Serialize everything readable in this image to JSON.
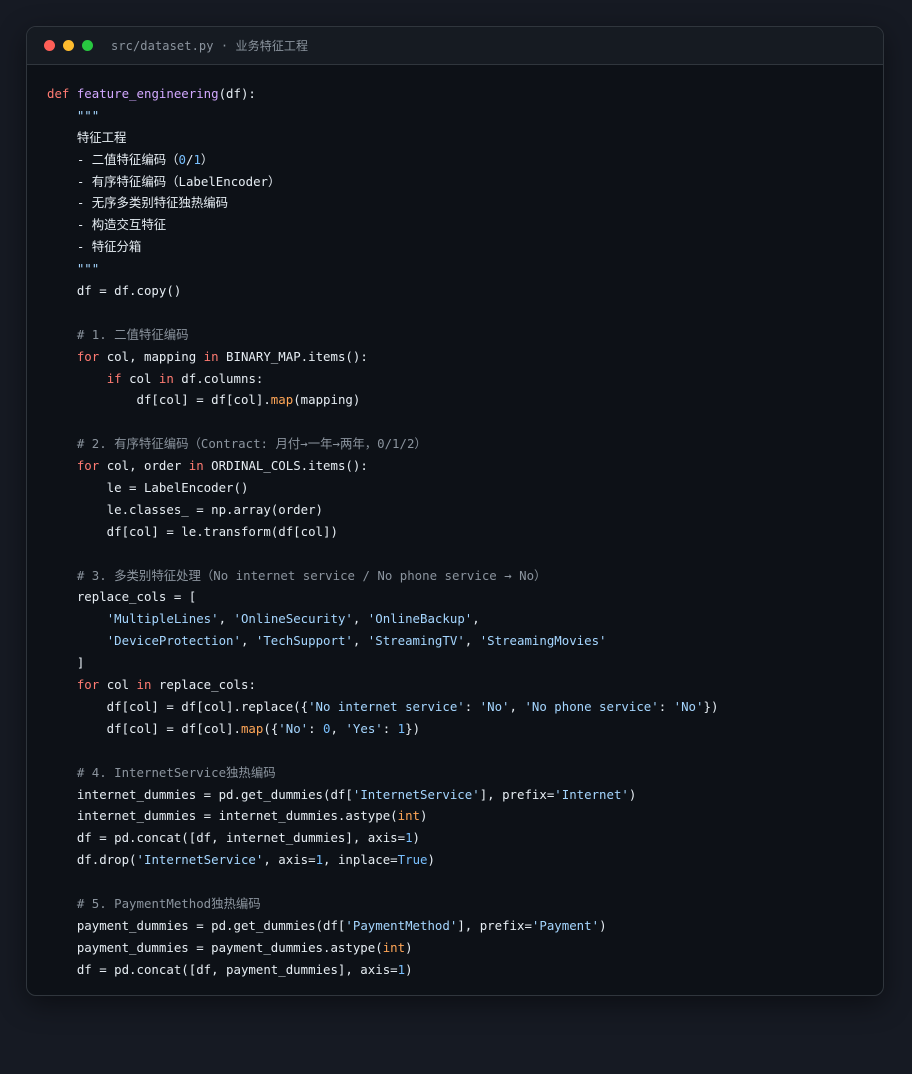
{
  "window": {
    "title": "src/dataset.py · 业务特征工程",
    "colors": {
      "close": "#ff5f57",
      "minimize": "#febc2e",
      "maximize": "#28c840",
      "background": "#0d1117",
      "keyword": "#ff7b72",
      "function": "#d2a8ff",
      "string": "#a5d6ff",
      "number": "#79c0ff",
      "comment": "#8b949e",
      "builtin": "#ffa657"
    }
  },
  "code_lines": [
    [
      [
        "kw",
        "def "
      ],
      [
        "fn",
        "feature_engineering"
      ],
      [
        "p",
        "(df):"
      ]
    ],
    [
      [
        "p",
        "    "
      ],
      [
        "str",
        "\"\"\""
      ]
    ],
    [
      [
        "p",
        "    特征工程"
      ]
    ],
    [
      [
        "p",
        "    - 二值特征编码（"
      ],
      [
        "num",
        "0"
      ],
      [
        "p",
        "/"
      ],
      [
        "num",
        "1"
      ],
      [
        "p",
        "）"
      ]
    ],
    [
      [
        "p",
        "    - 有序特征编码（LabelEncoder）"
      ]
    ],
    [
      [
        "p",
        "    - 无序多类别特征独热编码"
      ]
    ],
    [
      [
        "p",
        "    - 构造交互特征"
      ]
    ],
    [
      [
        "p",
        "    - 特征分箱"
      ]
    ],
    [
      [
        "p",
        "    "
      ],
      [
        "str",
        "\"\"\""
      ]
    ],
    [
      [
        "p",
        "    df = df.copy()"
      ]
    ],
    [],
    [
      [
        "p",
        "    "
      ],
      [
        "cmt",
        "# 1. 二值特征编码"
      ]
    ],
    [
      [
        "p",
        "    "
      ],
      [
        "kw",
        "for"
      ],
      [
        "p",
        " col, mapping "
      ],
      [
        "kw",
        "in"
      ],
      [
        "p",
        " BINARY_MAP.items():"
      ]
    ],
    [
      [
        "p",
        "        "
      ],
      [
        "kw",
        "if"
      ],
      [
        "p",
        " col "
      ],
      [
        "kw",
        "in"
      ],
      [
        "p",
        " df.columns:"
      ]
    ],
    [
      [
        "p",
        "            df[col] = df[col]."
      ],
      [
        "builtin",
        "map"
      ],
      [
        "p",
        "(mapping)"
      ]
    ],
    [],
    [
      [
        "p",
        "    "
      ],
      [
        "cmt",
        "# 2. 有序特征编码（Contract: 月付→一年→两年，0/1/2）"
      ]
    ],
    [
      [
        "p",
        "    "
      ],
      [
        "kw",
        "for"
      ],
      [
        "p",
        " col, order "
      ],
      [
        "kw",
        "in"
      ],
      [
        "p",
        " ORDINAL_COLS.items():"
      ]
    ],
    [
      [
        "p",
        "        le = LabelEncoder()"
      ]
    ],
    [
      [
        "p",
        "        le.classes_ = np.array(order)"
      ]
    ],
    [
      [
        "p",
        "        df[col] = le.transform(df[col])"
      ]
    ],
    [],
    [
      [
        "p",
        "    "
      ],
      [
        "cmt",
        "# 3. 多类别特征处理（No internet service / No phone service → No）"
      ]
    ],
    [
      [
        "p",
        "    replace_cols = ["
      ]
    ],
    [
      [
        "p",
        "        "
      ],
      [
        "str",
        "'MultipleLines'"
      ],
      [
        "p",
        ", "
      ],
      [
        "str",
        "'OnlineSecurity'"
      ],
      [
        "p",
        ", "
      ],
      [
        "str",
        "'OnlineBackup'"
      ],
      [
        "p",
        ","
      ]
    ],
    [
      [
        "p",
        "        "
      ],
      [
        "str",
        "'DeviceProtection'"
      ],
      [
        "p",
        ", "
      ],
      [
        "str",
        "'TechSupport'"
      ],
      [
        "p",
        ", "
      ],
      [
        "str",
        "'StreamingTV'"
      ],
      [
        "p",
        ", "
      ],
      [
        "str",
        "'StreamingMovies'"
      ]
    ],
    [
      [
        "p",
        "    ]"
      ]
    ],
    [
      [
        "p",
        "    "
      ],
      [
        "kw",
        "for"
      ],
      [
        "p",
        " col "
      ],
      [
        "kw",
        "in"
      ],
      [
        "p",
        " replace_cols:"
      ]
    ],
    [
      [
        "p",
        "        df[col] = df[col].replace({"
      ],
      [
        "str",
        "'No internet service'"
      ],
      [
        "p",
        ": "
      ],
      [
        "str",
        "'No'"
      ],
      [
        "p",
        ", "
      ],
      [
        "str",
        "'No phone service'"
      ],
      [
        "p",
        ": "
      ],
      [
        "str",
        "'No'"
      ],
      [
        "p",
        "})"
      ]
    ],
    [
      [
        "p",
        "        df[col] = df[col]."
      ],
      [
        "builtin",
        "map"
      ],
      [
        "p",
        "({"
      ],
      [
        "str",
        "'No'"
      ],
      [
        "p",
        ": "
      ],
      [
        "num",
        "0"
      ],
      [
        "p",
        ", "
      ],
      [
        "str",
        "'Yes'"
      ],
      [
        "p",
        ": "
      ],
      [
        "num",
        "1"
      ],
      [
        "p",
        "})"
      ]
    ],
    [],
    [
      [
        "p",
        "    "
      ],
      [
        "cmt",
        "# 4. InternetService独热编码"
      ]
    ],
    [
      [
        "p",
        "    internet_dummies = pd.get_dummies(df["
      ],
      [
        "str",
        "'InternetService'"
      ],
      [
        "p",
        "], prefix="
      ],
      [
        "str",
        "'Internet'"
      ],
      [
        "p",
        ")"
      ]
    ],
    [
      [
        "p",
        "    internet_dummies = internet_dummies.astype("
      ],
      [
        "builtin",
        "int"
      ],
      [
        "p",
        ")"
      ]
    ],
    [
      [
        "p",
        "    df = pd.concat([df, internet_dummies], axis="
      ],
      [
        "num",
        "1"
      ],
      [
        "p",
        ")"
      ]
    ],
    [
      [
        "p",
        "    df.drop("
      ],
      [
        "str",
        "'InternetService'"
      ],
      [
        "p",
        ", axis="
      ],
      [
        "num",
        "1"
      ],
      [
        "p",
        ", inplace="
      ],
      [
        "num",
        "True"
      ],
      [
        "p",
        ")"
      ]
    ],
    [],
    [
      [
        "p",
        "    "
      ],
      [
        "cmt",
        "# 5. PaymentMethod独热编码"
      ]
    ],
    [
      [
        "p",
        "    payment_dummies = pd.get_dummies(df["
      ],
      [
        "str",
        "'PaymentMethod'"
      ],
      [
        "p",
        "], prefix="
      ],
      [
        "str",
        "'Payment'"
      ],
      [
        "p",
        ")"
      ]
    ],
    [
      [
        "p",
        "    payment_dummies = payment_dummies.astype("
      ],
      [
        "builtin",
        "int"
      ],
      [
        "p",
        ")"
      ]
    ],
    [
      [
        "p",
        "    df = pd.concat([df, payment_dummies], axis="
      ],
      [
        "num",
        "1"
      ],
      [
        "p",
        ")"
      ]
    ]
  ]
}
